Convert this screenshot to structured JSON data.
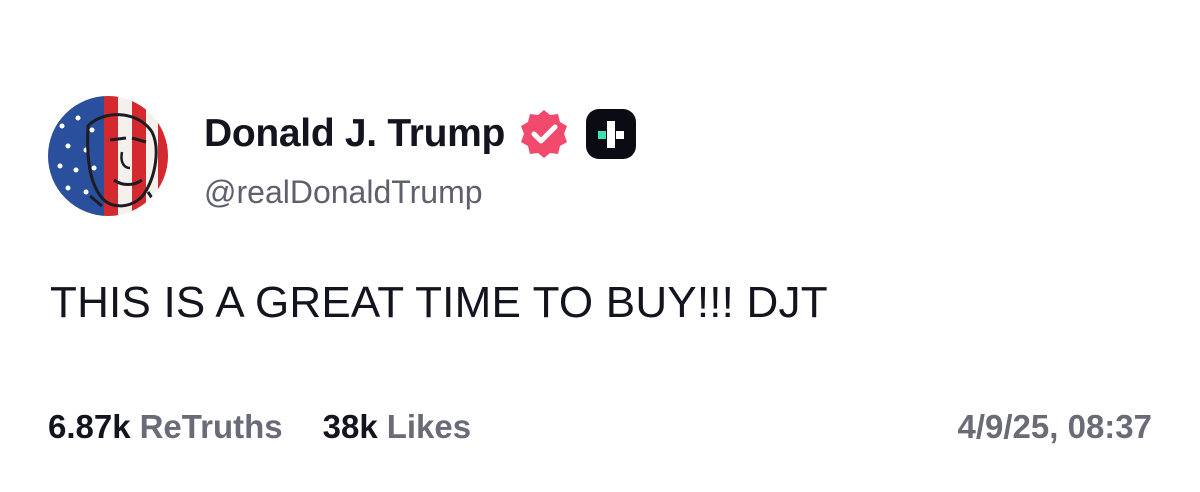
{
  "post": {
    "author": {
      "display_name": "Donald J. Trump",
      "handle": "@realDonaldTrump",
      "avatar_icon": "american-flag-portrait-avatar",
      "verified_icon": "verified-badge-icon",
      "platform_icon": "truth-social-logo-icon"
    },
    "text": "THIS IS A GREAT TIME TO BUY!!! DJT",
    "stats": {
      "retruths_count": "6.87k",
      "retruths_label": "ReTruths",
      "likes_count": "38k",
      "likes_label": "Likes"
    },
    "timestamp": "4/9/25, 08:37"
  },
  "colors": {
    "verified_badge": "#f24a6d",
    "logo_background": "#0b0b14",
    "logo_accent": "#3fe0b8",
    "text_primary": "#14141f",
    "text_secondary": "#6b6b78"
  }
}
